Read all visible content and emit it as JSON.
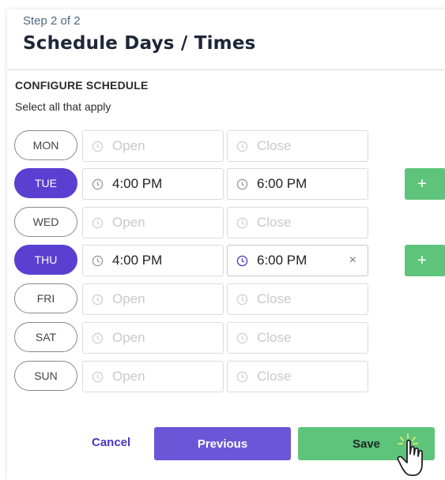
{
  "header": {
    "step": "Step 2 of 2",
    "title": "Schedule Days / Times"
  },
  "section": {
    "title": "CONFIGURE SCHEDULE",
    "subtitle": "Select all that apply"
  },
  "rows": [
    {
      "day": "MON",
      "active": false,
      "open": "Open",
      "close": "Close"
    },
    {
      "day": "TUE",
      "active": true,
      "open": "4:00 PM",
      "close": "6:00 PM",
      "add_label": "+"
    },
    {
      "day": "WED",
      "active": false,
      "open": "Open",
      "close": "Close"
    },
    {
      "day": "THU",
      "active": true,
      "open": "4:00 PM",
      "close": "6:00 PM",
      "clear_label": "×",
      "add_label": "+"
    },
    {
      "day": "FRI",
      "active": false,
      "open": "Open",
      "close": "Close"
    },
    {
      "day": "SAT",
      "active": false,
      "open": "Open",
      "close": "Close"
    },
    {
      "day": "SUN",
      "active": false,
      "open": "Open",
      "close": "Close"
    }
  ],
  "footer": {
    "cancel_label": "Cancel",
    "previous_label": "Previous",
    "save_label": "Save"
  },
  "colors": {
    "accent": "#5a3fd1",
    "save": "#5ec47c",
    "add": "#5ec47c",
    "focus_clock": "#5a3fd1"
  },
  "icons": {
    "clock": "clock-icon",
    "clear": "clear-icon",
    "add": "plus-icon",
    "cursor": "hand-pointer-icon"
  }
}
